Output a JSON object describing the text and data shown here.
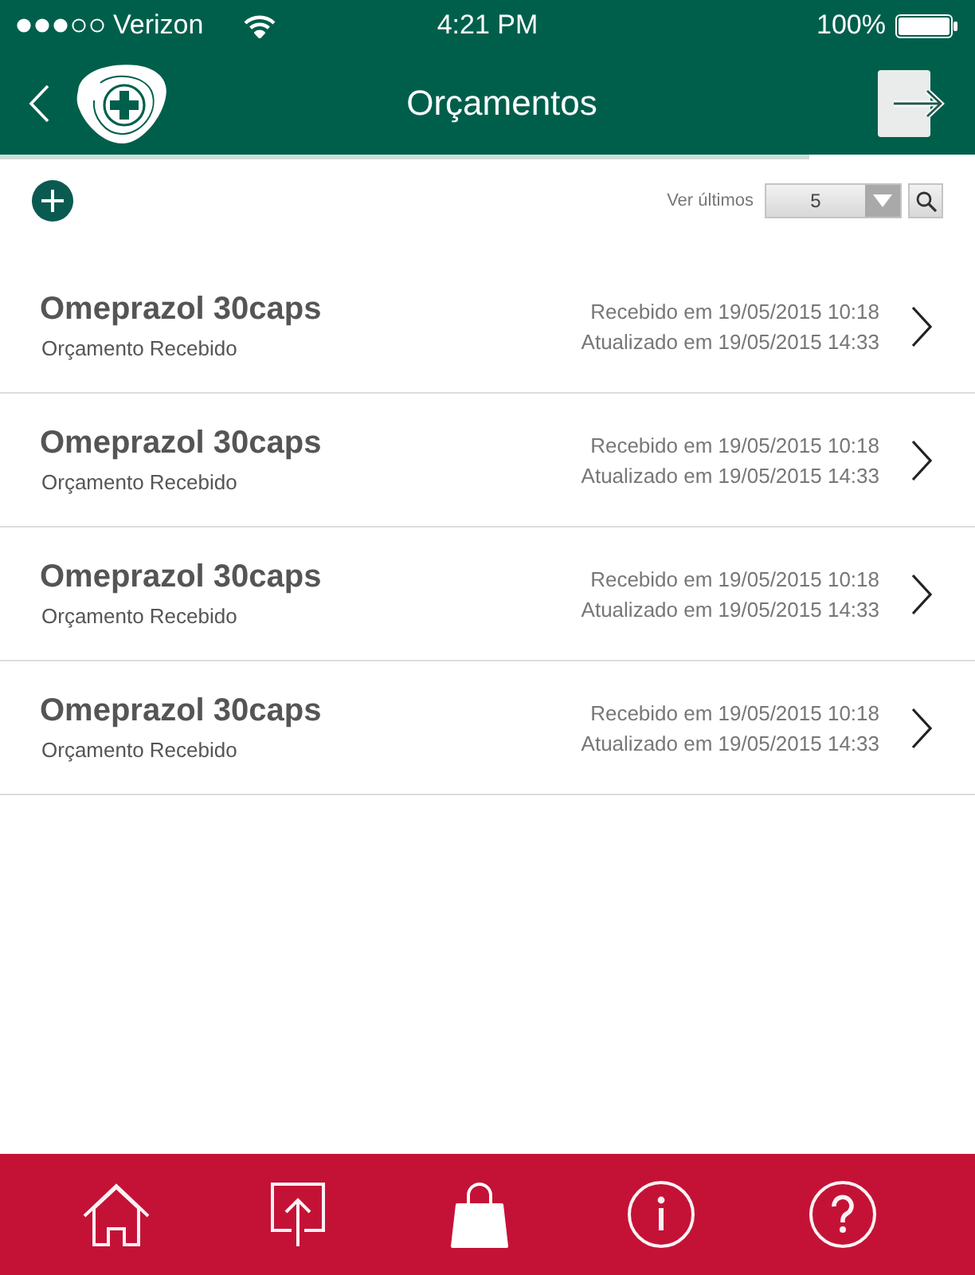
{
  "status_bar": {
    "carrier": "Verizon",
    "time": "4:21 PM",
    "battery": "100%"
  },
  "nav_bar": {
    "title": "Orçamentos"
  },
  "loading_bar": {
    "level": 0.83
  },
  "toolbar": {
    "filter_label": "Ver últimos",
    "filter_value": "5"
  },
  "quotes": [
    {
      "title": "Omeprazol 30caps",
      "status": "Orçamento Recebido",
      "received": "Recebido em 19/05/2015 10:18",
      "updated": "Atualizado em 19/05/2015 14:33"
    },
    {
      "title": "Omeprazol 30caps",
      "status": "Orçamento Recebido",
      "received": "Recebido em 19/05/2015 10:18",
      "updated": "Atualizado em 19/05/2015 14:33"
    },
    {
      "title": "Omeprazol 30caps",
      "status": "Orçamento Recebido",
      "received": "Recebido em 19/05/2015 10:18",
      "updated": "Atualizado em 19/05/2015 14:33"
    },
    {
      "title": "Omeprazol 30caps",
      "status": "Orçamento Recebido",
      "received": "Recebido em 19/05/2015 10:18",
      "updated": "Atualizado em 19/05/2015 14:33"
    }
  ],
  "tab_bar": [
    {
      "kind": "home",
      "selected": false
    },
    {
      "kind": "share",
      "selected": false
    },
    {
      "kind": "bag",
      "selected": true
    },
    {
      "kind": "info",
      "selected": false
    },
    {
      "kind": "help",
      "selected": false
    }
  ]
}
